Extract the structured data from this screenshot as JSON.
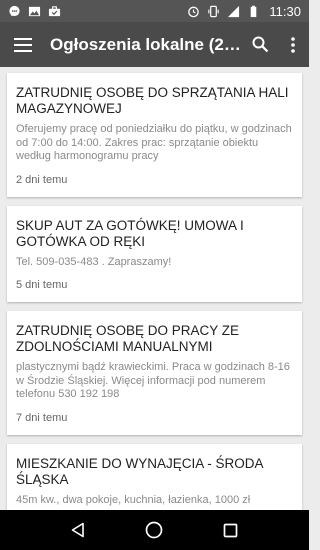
{
  "status_bar": {
    "time": "11:30",
    "left_icons": [
      "chat-icon",
      "image-icon",
      "briefcase-icon"
    ],
    "right_icons": [
      "alarm-icon",
      "vibrate-icon",
      "signal-icon",
      "battery-icon"
    ]
  },
  "app_bar": {
    "title": "Ogłoszenia lokalne (2…",
    "menu_icon": "hamburger-menu-icon",
    "search_icon": "search-icon",
    "more_icon": "more-vertical-icon"
  },
  "listings": [
    {
      "title": "ZATRUDNIĘ OSOBĘ DO SPRZĄTANIA  HALI MAGAZYNOWEJ",
      "body": "Oferujemy pracę od poniedziałku do piątku, w godzinach  od 7:00 do 14:00.  Zakres prac: sprzątanie obiektu według harmonogramu pracy",
      "date": "2 dni temu"
    },
    {
      "title": "SKUP AUT ZA GOTÓWKĘ! UMOWA I GOTÓWKA OD RĘKI",
      "body": "Tel. 509-035-483 . Zapraszamy!",
      "date": "5 dni temu"
    },
    {
      "title": "ZATRUDNIĘ OSOBĘ DO PRACY ZE ZDOLNOŚCIAMI MANUALNYMI",
      "body": "plastycznymi bądź krawieckimi. Praca w godzinach 8-16 w Środzie Śląskiej. Więcej informacji pod numerem telefonu 530 192 198",
      "date": "7 dni temu"
    },
    {
      "title": "MIESZKANIE DO WYNAJĘCIA - ŚRODA ŚLĄSKA",
      "body": "45m kw., dwa pokoje, kuchnia, łazienka, 1000 zł",
      "date": ""
    }
  ],
  "nav_bar": {
    "back_icon": "back-triangle-icon",
    "home_icon": "home-circle-icon",
    "recents_icon": "recents-square-icon"
  }
}
